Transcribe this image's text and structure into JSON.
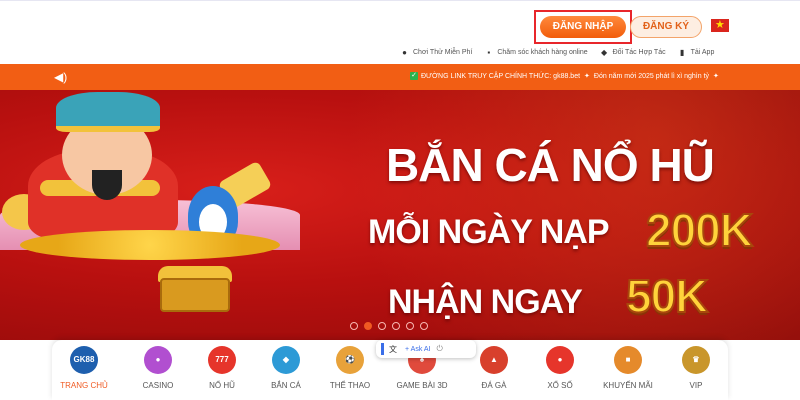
{
  "header": {
    "login_label": "ĐĂNG NHẬP",
    "register_label": "ĐĂNG KÝ",
    "flag_icon": "vietnam-flag-icon",
    "links": [
      {
        "icon": "gamepad-icon",
        "label": "Chơi Thử Miễn Phí"
      },
      {
        "icon": "chat-icon",
        "label": "Chăm sóc khách hàng online"
      },
      {
        "icon": "handshake-icon",
        "label": "Đối Tác Hợp Tác"
      },
      {
        "icon": "phone-icon",
        "label": "Tải App"
      }
    ]
  },
  "notice": {
    "speaker_icon": "speaker-icon",
    "official_link_text": "ĐƯỜNG LINK TRUY CẬP CHÍNH THỨC: gk88.bet",
    "promo_text": "Đón năm mới 2025 phát lì xì nghìn tỷ"
  },
  "banner": {
    "line1": "BẮN CÁ NỔ HŨ",
    "line2": "MỖI NGÀY NẠP",
    "line2_value": "200K",
    "line3": "NHẬN NGAY",
    "line3_value": "50K",
    "slide_count": 6,
    "active_slide": 2
  },
  "assistant_popup": {
    "ask_label": "Ask AI"
  },
  "nav": {
    "items": [
      {
        "label": "TRANG CHỦ",
        "icon": "gk88-logo-icon",
        "icon_text": "GK88",
        "color": "#1e5fae",
        "active": true
      },
      {
        "label": "CASINO",
        "icon": "casino-chip-icon",
        "icon_text": "",
        "color": "#b14fd0",
        "active": false
      },
      {
        "label": "NỔ HŨ",
        "icon": "slot-icon",
        "icon_text": "777",
        "color": "#e6352b",
        "active": false
      },
      {
        "label": "BẮN CÁ",
        "icon": "fish-icon",
        "icon_text": "",
        "color": "#2d9ad6",
        "active": false
      },
      {
        "label": "THỂ THAO",
        "icon": "soccer-ball-icon",
        "icon_text": "",
        "color": "#e8a23a",
        "active": false
      },
      {
        "label": "GAME BÀI 3D",
        "icon": "cards-icon",
        "icon_text": "",
        "color": "#e04a3c",
        "active": false
      },
      {
        "label": "ĐÁ GÀ",
        "icon": "rooster-icon",
        "icon_text": "",
        "color": "#d8402c",
        "active": false
      },
      {
        "label": "XỔ SỐ",
        "icon": "lottery-ball-icon",
        "icon_text": "",
        "color": "#e6352b",
        "active": false
      },
      {
        "label": "KHUYẾN MÃI",
        "icon": "gift-icon",
        "icon_text": "",
        "color": "#e58a2b",
        "active": false
      },
      {
        "label": "VIP",
        "icon": "vip-crown-icon",
        "icon_text": "",
        "color": "#c9962b",
        "active": false
      }
    ]
  }
}
